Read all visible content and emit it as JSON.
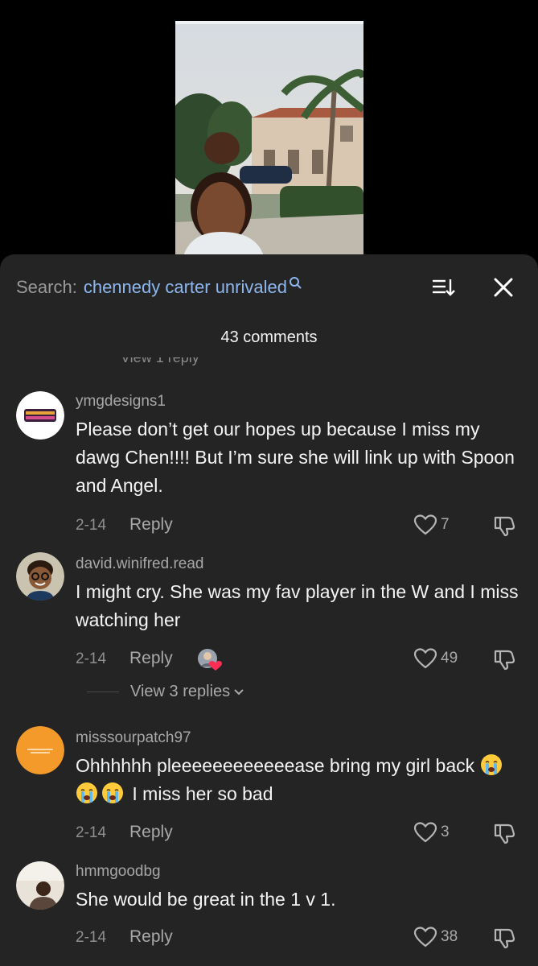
{
  "search": {
    "label": "Search:",
    "query": "chennedy carter unrivaled"
  },
  "comments_header": {
    "count_label": "43 comments",
    "cut_text": "View 1 reply"
  },
  "comments": [
    {
      "username": "ymgdesigns1",
      "text": "Please don’t get our hopes up because I miss my dawg Chen!!!! But I’m sure she will link up with Spoon and Angel.",
      "date": "2-14",
      "reply": "Reply",
      "likes": "7"
    },
    {
      "username": "david.winifred.read",
      "text": "I might cry. She was my fav player in the W and I miss watching her",
      "date": "2-14",
      "reply": "Reply",
      "likes": "49",
      "view_replies": "View 3 replies"
    },
    {
      "username": "misssourpatch97",
      "text_before": "Ohhhhhh pleeeeeeeeeeeease bring my girl back",
      "text_after": "I miss her so bad",
      "date": "2-14",
      "reply": "Reply",
      "likes": "3"
    },
    {
      "username": "hmmgoodbg",
      "text": "She would be great in the 1 v 1.",
      "date": "2-14",
      "reply": "Reply",
      "likes": "38"
    }
  ],
  "colors": {
    "sheet_bg": "#242424",
    "query": "#8db7ee",
    "heart_red": "#ff2d55"
  },
  "icons": [
    "search-glass-icon",
    "sort-icon",
    "close-icon",
    "heart-outline-icon",
    "dislike-icon",
    "chevron-down-icon",
    "crying-face-emoji"
  ]
}
